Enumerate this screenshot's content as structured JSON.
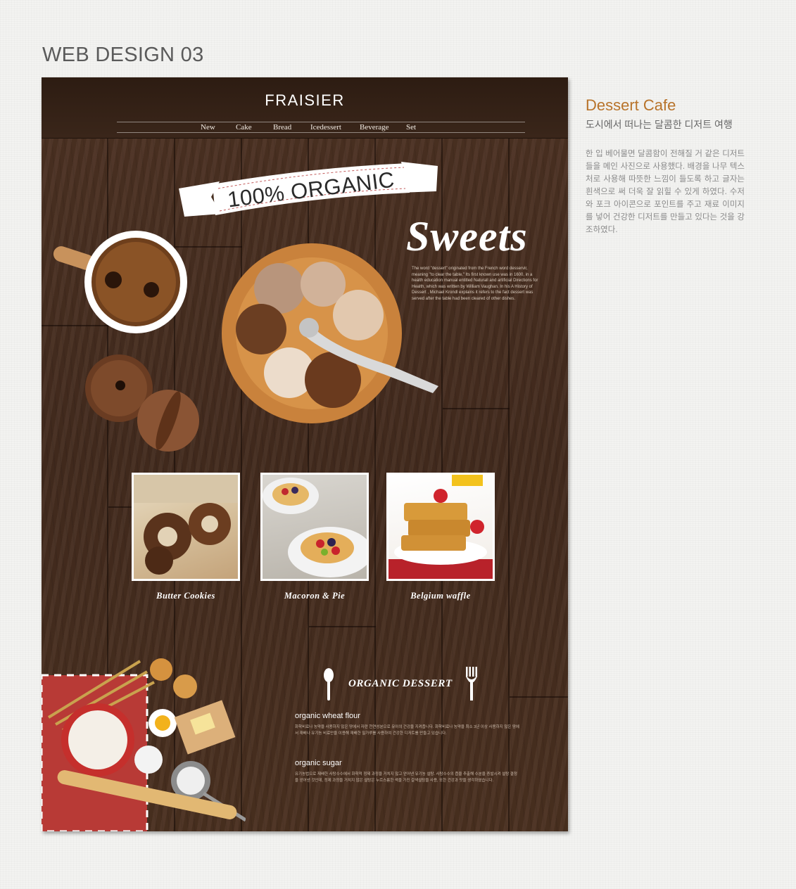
{
  "page": {
    "heading": "WEB DESIGN 03"
  },
  "mockup": {
    "brand": "FRAISIER",
    "nav": [
      "New",
      "Cake",
      "Bread",
      "Icedessert",
      "Beverage",
      "Set"
    ],
    "banner_text": "100% ORGANIC",
    "sweets_title": "Sweets",
    "sweets_description": "The word \"dessert\" originated from the French word desservir, meaning \"to clear the table.\" Its first known use was in 1600, in a health education manual entitled Naturall and artificial Directions for Health, which was written by William Vaughan. In his A History of Dessert , Michael Krondl explains it refers to the fact dessert was served after the table had been cleared of other dishes.",
    "products": [
      {
        "caption": "Butter Cookies"
      },
      {
        "caption": "Macoron & Pie"
      },
      {
        "caption": "Belgium waffle"
      }
    ],
    "organic_heading": "ORGANIC DESSERT",
    "organic_items": [
      {
        "title": "organic wheat flour",
        "text": "화학비료나 농약을 사용하지 않은 땅에서 자란 천연성분으로 유아의 건강을 지켜줍니다. 화학비료나 농약을 최소 3년 이상 사용하지 않은 땅에서 재배나 유기농 비료만을 이용해 재배한 밀가루를 사용하여 건강한 디저트를 만들고 있습니다."
      },
      {
        "title": "organic sugar",
        "text": "유기농법으로 재배한 사탕수수에서 화학적 정제 과정을 거치지 않고 얻어낸 유기농 설탕. 사탕수수의 즙을 추출해 수분을 증발시켜 설탕 결정을 얻어낸 것인데, 정제 과정을 거치지 않은 설탕은 누르스름한 색을 가진 갈색설탕을 사용, 또한 건강과 맛을 생각하였습니다."
      }
    ]
  },
  "side": {
    "title": "Dessert Cafe",
    "subtitle": "도시에서 떠나는 달콤한 디저트 여행",
    "body": "한 입 베어물면 달콤함이 전해질 거 같은 디저트들을 메인 사진으로 사용했다. 배경을 나무 텍스처로 사용해 따뜻한 느낌이 들도록 하고 글자는 흰색으로 써 더욱 잘 읽힐 수 있게 하였다. 수저와 포크 아이콘으로 포인트를 주고 재료 이미지를 넣어 건강한 디저트를 만들고 있다는 것을 강조하였다."
  },
  "colors": {
    "accent": "#b8732a",
    "wood": "#4a3022",
    "header_bar": "#2d1c12"
  },
  "icons": [
    "spoon-icon",
    "fork-icon"
  ]
}
